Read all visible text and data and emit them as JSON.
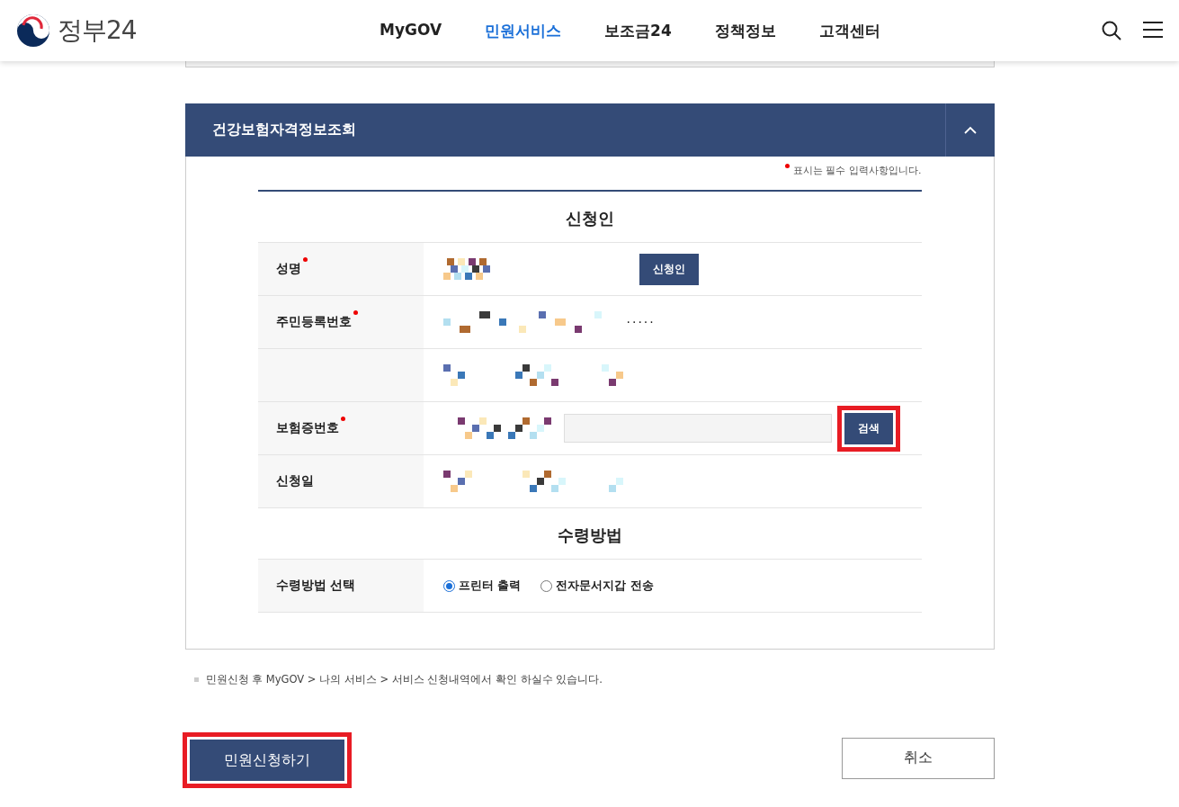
{
  "header": {
    "logo_text": "정부24",
    "nav": [
      {
        "label": "MyGOV",
        "selected": false
      },
      {
        "label": "민원서비스",
        "selected": true
      },
      {
        "label": "보조금24",
        "selected": false
      },
      {
        "label": "정책정보",
        "selected": false
      },
      {
        "label": "고객센터",
        "selected": false
      }
    ]
  },
  "section": {
    "title": "건강보험자격정보조회",
    "expanded": true,
    "required_note": "표시는 필수 입력사항입니다.",
    "groups": [
      {
        "title": "신청인",
        "rows": [
          {
            "label": "성명",
            "required": true,
            "kind": "button",
            "button": "신청인"
          },
          {
            "label": "주민등록번호",
            "required": true,
            "kind": "masked",
            "masked": "·····"
          },
          {
            "required": false,
            "kind": "redacted"
          },
          {
            "label": "보험증번호",
            "required": true,
            "kind": "search",
            "button": "검색",
            "highlighted": true
          },
          {
            "label": "신청일",
            "required": false,
            "kind": "redacted"
          }
        ]
      },
      {
        "title": "수령방법",
        "rows": [
          {
            "label": "수령방법 선택",
            "required": false,
            "kind": "radio",
            "options": [
              {
                "label": "프린터 출력",
                "selected": true
              },
              {
                "label": "전자문서지갑 전송",
                "selected": false
              }
            ]
          }
        ]
      }
    ]
  },
  "note": "민원신청 후 MyGOV > 나의 서비스 > 서비스 신청내역에서 확인 하실수 있습니다.",
  "actions": [
    {
      "label": "민원신청하기",
      "kind": "primary",
      "highlighted": true
    },
    {
      "label": "취소",
      "kind": "secondary",
      "highlighted": false
    }
  ]
}
